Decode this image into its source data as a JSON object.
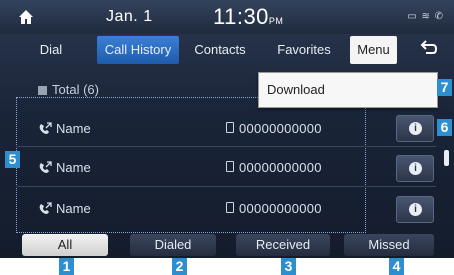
{
  "status_bar": {
    "date": "Jan. 1",
    "time": "11:30",
    "time_suffix": "PM",
    "status_icons": "▭ ≋ ✆"
  },
  "tabs": [
    {
      "label": "Dial"
    },
    {
      "label": "Call History"
    },
    {
      "label": "Contacts"
    },
    {
      "label": "Favorites"
    }
  ],
  "menu_label": "Menu",
  "back_symbol": "↩",
  "list": {
    "total_label": "Total (6)",
    "rows": [
      {
        "name": "Name",
        "number": "00000000000"
      },
      {
        "name": "Name",
        "number": "00000000000"
      },
      {
        "name": "Name",
        "number": "00000000000"
      }
    ]
  },
  "dropdown": {
    "items": [
      "Download"
    ]
  },
  "filters": [
    {
      "label": "All"
    },
    {
      "label": "Dialed"
    },
    {
      "label": "Received"
    },
    {
      "label": "Missed"
    }
  ],
  "callouts": [
    "1",
    "2",
    "3",
    "4",
    "5",
    "6",
    "7"
  ],
  "colors": {
    "accent": "#2e8fd0",
    "active_tab": "#1f5cab"
  }
}
